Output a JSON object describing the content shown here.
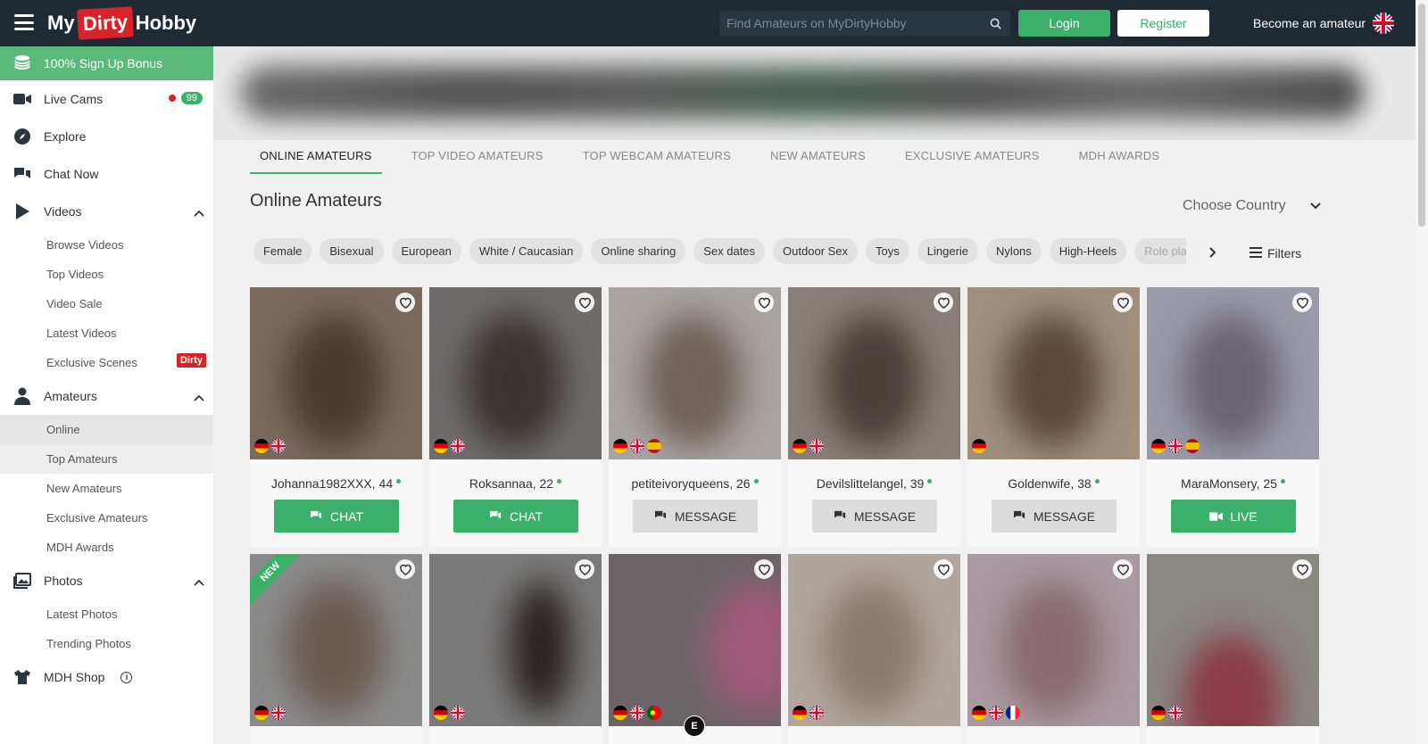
{
  "header": {
    "logo_left": "My",
    "logo_mid": "Dirty",
    "logo_right": "Hobby",
    "search_placeholder": "Find Amateurs on MyDirtyHobby",
    "login_label": "Login",
    "register_label": "Register",
    "become_label": "Become an amateur"
  },
  "sidebar": {
    "bonus": "100% Sign Up Bonus",
    "live_cams": "Live Cams",
    "live_count": "99",
    "explore": "Explore",
    "chat_now": "Chat Now",
    "videos": "Videos",
    "videos_sub": [
      "Browse Videos",
      "Top Videos",
      "Video Sale",
      "Latest Videos",
      "Exclusive Scenes"
    ],
    "dirtymax_label": "Dirty",
    "amateurs": "Amateurs",
    "amateurs_sub": [
      "Online",
      "Top Amateurs",
      "New Amateurs",
      "Exclusive Amateurs",
      "MDH Awards"
    ],
    "photos": "Photos",
    "photos_sub": [
      "Latest Photos",
      "Trending Photos"
    ],
    "shop": "MDH Shop"
  },
  "main": {
    "tabs": [
      "ONLINE AMATEURS",
      "TOP VIDEO AMATEURS",
      "TOP WEBCAM AMATEURS",
      "NEW AMATEURS",
      "EXCLUSIVE AMATEURS",
      "MDH AWARDS"
    ],
    "heading": "Online Amateurs",
    "country_select": "Choose Country",
    "chips": [
      "Female",
      "Bisexual",
      "European",
      "White / Caucasian",
      "Online sharing",
      "Sex dates",
      "Outdoor Sex",
      "Toys",
      "Lingerie",
      "Nylons",
      "High-Heels",
      "Role play"
    ],
    "filters_label": "Filters",
    "new_label": "NEW",
    "e_label": "E",
    "cards_row1": [
      {
        "name": "Johanna1982XXX, 44",
        "cta": "CHAT"
      },
      {
        "name": "Roksannaa, 22",
        "cta": "CHAT"
      },
      {
        "name": "petiteivoryqueens, 26",
        "cta": "MESSAGE"
      },
      {
        "name": "Devilslittelangel, 39",
        "cta": "MESSAGE"
      },
      {
        "name": "Goldenwife, 38",
        "cta": "MESSAGE"
      },
      {
        "name": "MaraMonsery, 25",
        "cta": "LIVE"
      }
    ]
  },
  "colors": {
    "accent_green": "#3bb06b",
    "brand_red": "#d8232a",
    "header_bg": "#1f2a33"
  }
}
